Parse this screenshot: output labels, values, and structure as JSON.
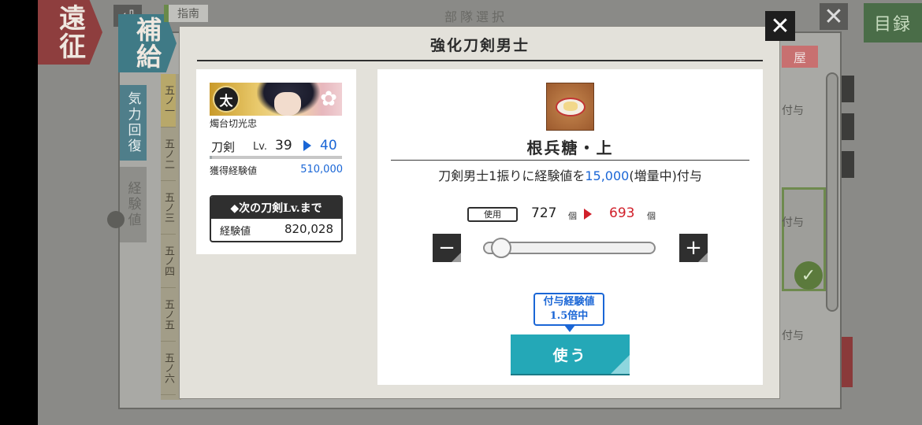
{
  "background": {
    "expedition_label": "遠征",
    "supply_label": "補給",
    "back_label": "⏎",
    "designate_label": "指南",
    "heading": "部隊選択",
    "catalog_label": "目録",
    "close_label": "✕",
    "side_kiryoku_label": "気力回復",
    "side_keiken_label": "経験値",
    "shop_label": "屋",
    "fuyo_1": "付与",
    "fuyo_2": "付与",
    "slots": [
      "五ノ一",
      "五ノ二",
      "五ノ三",
      "五ノ四",
      "五ノ五",
      "五ノ六"
    ]
  },
  "modal": {
    "title": "強化刀剣男士",
    "close_label": "✕"
  },
  "sword": {
    "type_badge": "太",
    "name": "燭台切光忠",
    "type_label": "刀剣",
    "level_label": "Lv.",
    "level_current": "39",
    "level_next": "40",
    "exp_progress": 0.02,
    "exp_gain_label": "獲得経験値",
    "exp_gain_value": "510,000",
    "next_header": "◆次の刀剣Lv.まで",
    "next_label": "経験値",
    "next_value": "820,028"
  },
  "item": {
    "icon": "konpeito-icon",
    "name": "根兵糖・上",
    "desc_before": "刀剣男士1振りに経験値を",
    "desc_amount": "15,000",
    "desc_after": "(増量中)付与",
    "use_tag": "使用",
    "owned_count": "727",
    "unit": "個",
    "after_count": "693",
    "minus_label": "−",
    "plus_label": "+",
    "slider_value": 0.05,
    "bonus_line1": "付与経験値",
    "bonus_line2": "1.5倍中",
    "use_button_label": "使う"
  },
  "colors": {
    "accent_blue": "#1a66d6",
    "accent_red": "#d11f2a",
    "use_button": "#24a8b7"
  }
}
